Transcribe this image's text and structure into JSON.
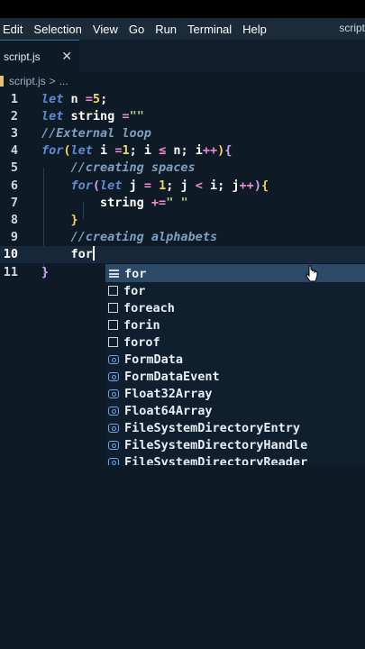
{
  "menu": {
    "items": [
      "Edit",
      "Selection",
      "View",
      "Go",
      "Run",
      "Terminal",
      "Help"
    ],
    "window_title": "script"
  },
  "tab": {
    "label": "script.js",
    "close": "✕"
  },
  "breadcrumb": {
    "file": "script.js",
    "sep": ">",
    "rest": "..."
  },
  "editor": {
    "line_numbers": [
      "1",
      "2",
      "3",
      "4",
      "5",
      "6",
      "7",
      "8",
      "9",
      "10",
      "11"
    ],
    "lines": [
      [
        [
          "kw",
          "let"
        ],
        [
          "id",
          " n "
        ],
        [
          "op",
          "="
        ],
        [
          "num-lit",
          "5"
        ],
        [
          "id",
          ";"
        ]
      ],
      [
        [
          "kw",
          "let"
        ],
        [
          "id",
          " string "
        ],
        [
          "op",
          "="
        ],
        [
          "str",
          "\"\""
        ]
      ],
      [
        [
          "cmt",
          "//External loop"
        ]
      ],
      [
        [
          "kw",
          "for"
        ],
        [
          "brk",
          "("
        ],
        [
          "kw",
          "let"
        ],
        [
          "id",
          " i "
        ],
        [
          "op",
          "="
        ],
        [
          "num-lit",
          "1"
        ],
        [
          "id",
          "; i "
        ],
        [
          "op",
          "≤"
        ],
        [
          "id",
          " n; i"
        ],
        [
          "op",
          "++"
        ],
        [
          "brk",
          ")"
        ],
        [
          "brace",
          "{"
        ]
      ],
      [
        [
          "id",
          "    "
        ],
        [
          "cmt",
          "//creating spaces"
        ]
      ],
      [
        [
          "id",
          "    "
        ],
        [
          "kw",
          "for"
        ],
        [
          "brace",
          "("
        ],
        [
          "kw",
          "let"
        ],
        [
          "id",
          " j "
        ],
        [
          "op",
          "="
        ],
        [
          "id",
          " "
        ],
        [
          "num-lit",
          "1"
        ],
        [
          "id",
          "; j "
        ],
        [
          "op",
          "<"
        ],
        [
          "id",
          " i; j"
        ],
        [
          "op",
          "++"
        ],
        [
          "brace",
          ")"
        ],
        [
          "brk",
          "{"
        ]
      ],
      [
        [
          "id",
          "        string "
        ],
        [
          "op",
          "+="
        ],
        [
          "str",
          "\" \""
        ]
      ],
      [
        [
          "id",
          "    "
        ],
        [
          "brk",
          "}"
        ]
      ],
      [
        [
          "id",
          "    "
        ],
        [
          "cmt",
          "//creating alphabets"
        ]
      ],
      [
        [
          "id",
          "    for"
        ]
      ],
      [
        [
          "brace",
          "}"
        ]
      ]
    ]
  },
  "suggestions": [
    {
      "label": "for",
      "icon": "keyword"
    },
    {
      "label": "for",
      "icon": "snippet"
    },
    {
      "label": "foreach",
      "icon": "snippet"
    },
    {
      "label": "forin",
      "icon": "snippet"
    },
    {
      "label": "forof",
      "icon": "snippet"
    },
    {
      "label": "FormData",
      "icon": "interface"
    },
    {
      "label": "FormDataEvent",
      "icon": "interface"
    },
    {
      "label": "Float32Array",
      "icon": "interface"
    },
    {
      "label": "Float64Array",
      "icon": "interface"
    },
    {
      "label": "FileSystemDirectoryEntry",
      "icon": "interface"
    },
    {
      "label": "FileSystemDirectoryHandle",
      "icon": "interface"
    },
    {
      "label": "FileSystemDirectoryReader",
      "icon": "interface"
    }
  ],
  "colors": {
    "menubar_bg": "#1b2b3a",
    "editor_bg": "#0e1a26",
    "suggest_selected": "#2c4a66",
    "keyword": "#5b8dd6",
    "number": "#f2d95c",
    "string": "#a8d08a",
    "comment": "#7fa0c0",
    "operator": "#f08bd3"
  }
}
